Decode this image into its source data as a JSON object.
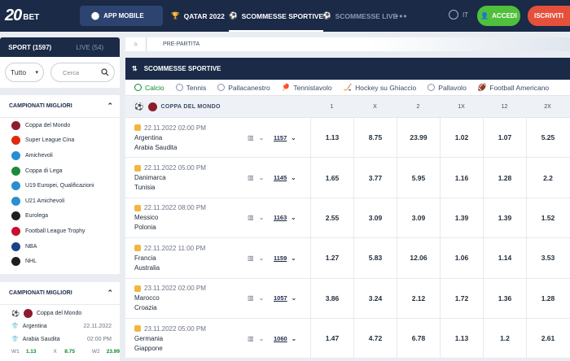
{
  "header": {
    "logo_num": "20",
    "logo_bet": "BET",
    "app_mobile": "APP MOBILE",
    "nav": [
      {
        "label": "QATAR 2022"
      },
      {
        "label": "SCOMMESSE SPORTIVE"
      },
      {
        "label": "SCOMMESSE LIVE"
      }
    ],
    "more": "•••",
    "lang": "IT",
    "login": "ACCEDI",
    "register": "ISCRIVITI"
  },
  "sidebar": {
    "sport_tab": "SPORT (1597)",
    "live_tab": "LIVE (54)",
    "filter_value": "Tutto",
    "search_placeholder": "Cerca",
    "leagues_title": "CAMPIONATI MIGLIORI",
    "leagues": [
      {
        "name": "Coppa del Mondo",
        "color": "#8b1d2c"
      },
      {
        "name": "Super League Cina",
        "color": "#de2910"
      },
      {
        "name": "Amichevoli",
        "color": "#2a8ecf"
      },
      {
        "name": "Coppa di Lega",
        "color": "#1f8a3a"
      },
      {
        "name": "U19 Europei, Qualificazioni",
        "color": "#2a8ecf"
      },
      {
        "name": "U21 Amichevoli",
        "color": "#2a8ecf"
      },
      {
        "name": "Eurolega",
        "color": "#1e1e1e"
      },
      {
        "name": "Football League Trophy",
        "color": "#c8102e"
      },
      {
        "name": "NBA",
        "color": "#1d428a"
      },
      {
        "name": "NHL",
        "color": "#1e1e1e"
      }
    ],
    "card2_title": "CAMPIONATI MIGLIORI",
    "card2_league": "Coppa del Mondo",
    "card2_home": "Argentina",
    "card2_away": "Arabia Saudita",
    "card2_date": "22.11.2022",
    "card2_time": "02:00 PM",
    "card2_odds": [
      {
        "k": "W1",
        "v": "1.13"
      },
      {
        "k": "X",
        "v": "8.75"
      },
      {
        "k": "W2",
        "v": "23.99"
      }
    ]
  },
  "main": {
    "breadcrumb": "PRE-PARTITA",
    "section_title": "SCOMMESSE SPORTIVE",
    "sport_tabs": [
      "Calcio",
      "Tennis",
      "Pallacanestro",
      "Tennistavolo",
      "Hockey su Ghiaccio",
      "Pallavolo",
      "Football Americano"
    ],
    "league": "COPPA DEL MONDO",
    "columns": [
      "1",
      "X",
      "2",
      "1X",
      "12",
      "2X"
    ],
    "matches": [
      {
        "date": "22.11.2022 02:00 PM",
        "home": "Argentina",
        "away": "Arabia Saudita",
        "markets": "1157",
        "odds": [
          "1.13",
          "8.75",
          "23.99",
          "1.02",
          "1.07",
          "5.25"
        ]
      },
      {
        "date": "22.11.2022 05:00 PM",
        "home": "Danimarca",
        "away": "Tunisia",
        "markets": "1145",
        "odds": [
          "1.65",
          "3.77",
          "5.95",
          "1.16",
          "1.28",
          "2.2"
        ]
      },
      {
        "date": "22.11.2022 08:00 PM",
        "home": "Messico",
        "away": "Polonia",
        "markets": "1163",
        "odds": [
          "2.55",
          "3.09",
          "3.09",
          "1.39",
          "1.39",
          "1.52"
        ]
      },
      {
        "date": "22.11.2022 11:00 PM",
        "home": "Francia",
        "away": "Australia",
        "markets": "1159",
        "odds": [
          "1.27",
          "5.83",
          "12.06",
          "1.06",
          "1.14",
          "3.53"
        ]
      },
      {
        "date": "23.11.2022 02:00 PM",
        "home": "Marocco",
        "away": "Croazia",
        "markets": "1057",
        "odds": [
          "3.86",
          "3.24",
          "2.12",
          "1.72",
          "1.36",
          "1.28"
        ]
      },
      {
        "date": "23.11.2022 05:00 PM",
        "home": "Germania",
        "away": "Giappone",
        "markets": "1060",
        "odds": [
          "1.47",
          "4.72",
          "6.78",
          "1.13",
          "1.2",
          "2.61"
        ]
      }
    ]
  }
}
